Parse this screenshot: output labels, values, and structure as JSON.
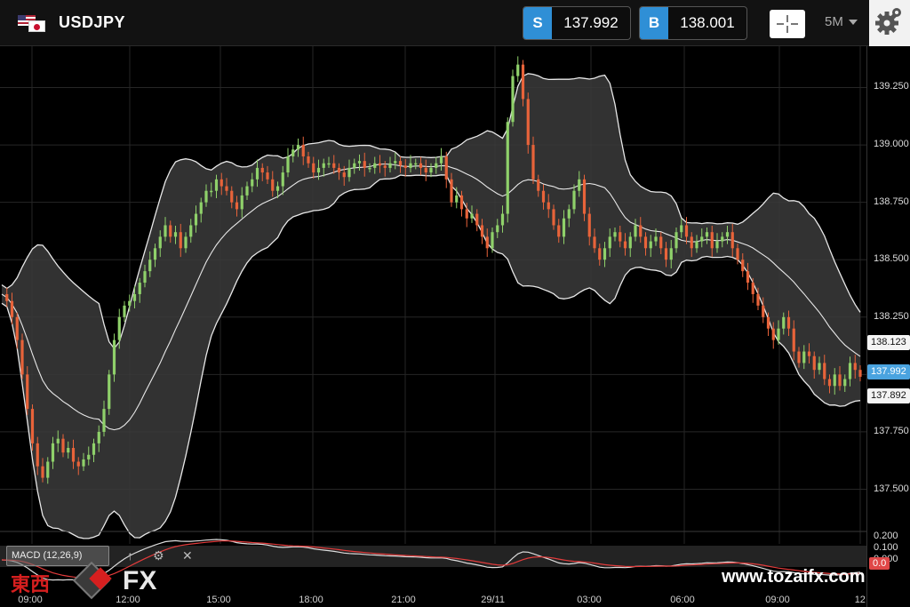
{
  "header": {
    "symbol": "USDJPY",
    "sell": {
      "tag": "S",
      "price": "137.992"
    },
    "buy": {
      "tag": "B",
      "price": "138.001"
    },
    "timeframe": "5M"
  },
  "chart_data": {
    "type": "candlestick",
    "title": "",
    "y_ticks": [
      "139.250",
      "139.000",
      "138.750",
      "138.500",
      "138.250",
      "138.000",
      "137.750",
      "137.500"
    ],
    "ylim": [
      137.32,
      139.43
    ],
    "x_ticks": [
      "09:00",
      "12:00",
      "15:00",
      "18:00",
      "21:00",
      "29/11",
      "03:00",
      "06:00",
      "09:00",
      "12"
    ],
    "price_tags": {
      "upper": "138.123",
      "current": "137.992",
      "lower": "137.892"
    },
    "indicators": [
      "Bollinger Bands"
    ],
    "series": [
      {
        "values": [
          138.35,
          138.32,
          138.25,
          138.15,
          138.0,
          137.85,
          137.7,
          137.6,
          137.55,
          137.62,
          137.7,
          137.72,
          137.66,
          137.68,
          137.62,
          137.6,
          137.63,
          137.65,
          137.7,
          137.75,
          137.85,
          138.0,
          138.15,
          138.25,
          138.3,
          138.32,
          138.35,
          138.4,
          138.45,
          138.5,
          138.55,
          138.6,
          138.65,
          138.6,
          138.62,
          138.55,
          138.6,
          138.65,
          138.7,
          138.75,
          138.8,
          138.8,
          138.85,
          138.82,
          138.8,
          138.75,
          138.72,
          138.78,
          138.82,
          138.85,
          138.9,
          138.88,
          138.85,
          138.8,
          138.82,
          138.88,
          138.95,
          138.98,
          139.0,
          138.95,
          138.92,
          138.88,
          138.9,
          138.92,
          138.92,
          138.9,
          138.88,
          138.86,
          138.9,
          138.92,
          138.93,
          138.9,
          138.9,
          138.92,
          138.91,
          138.9,
          138.92,
          138.93,
          138.91,
          138.9,
          138.92,
          138.92,
          138.9,
          138.88,
          138.9,
          138.92,
          138.95,
          138.85,
          138.75,
          138.78,
          138.72,
          138.68,
          138.7,
          138.65,
          138.6,
          138.55,
          138.62,
          138.65,
          138.7,
          139.1,
          139.3,
          139.35,
          139.2,
          139.0,
          138.85,
          138.8,
          138.75,
          138.72,
          138.65,
          138.6,
          138.68,
          138.72,
          138.8,
          138.85,
          138.7,
          138.6,
          138.55,
          138.5,
          138.55,
          138.6,
          138.62,
          138.58,
          138.55,
          138.6,
          138.65,
          138.6,
          138.55,
          138.58,
          138.6,
          138.55,
          138.5,
          138.55,
          138.62,
          138.65,
          138.6,
          138.55,
          138.58,
          138.6,
          138.62,
          138.55,
          138.58,
          138.6,
          138.62,
          138.55,
          138.5,
          138.45,
          138.4,
          138.35,
          138.3,
          138.25,
          138.2,
          138.15,
          138.2,
          138.25,
          138.2,
          138.1,
          138.05,
          138.1,
          138.08,
          138.02,
          138.05,
          137.98,
          137.95,
          138.0,
          137.95,
          137.98,
          138.05,
          138.02,
          137.99
        ]
      }
    ]
  },
  "macd": {
    "label": "MACD (12,26,9)",
    "y_ticks": [
      "0.200",
      "0.100",
      "0.000"
    ],
    "current": "0.0",
    "signal_color": "#e23b3b",
    "line_color": "#dddddd"
  },
  "colors": {
    "up": "#8fd16a",
    "down": "#e8633a",
    "band_fill": "#3b3b3b",
    "accent": "#2f8fd6"
  },
  "watermark": {
    "brand_kanji": "東西",
    "brand_fx": "FX",
    "site": "www.tozaifx.com"
  }
}
